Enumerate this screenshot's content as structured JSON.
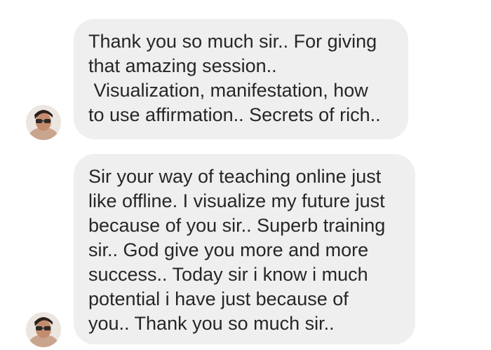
{
  "messages": [
    {
      "lines": [
        "Thank you so much sir.. For giving",
        "that amazing session..",
        " Visualization, manifestation, how",
        "to use affirmation.. Secrets of rich.."
      ]
    },
    {
      "lines": [
        "Sir your way of teaching online just",
        "like offline. I visualize my future just",
        "because of you sir.. Superb training",
        "sir.. God give you more and more",
        "success.. Today sir i know i much",
        "potential i have just because of",
        "you.. Thank you so much sir.."
      ]
    }
  ],
  "colors": {
    "bubble_bg": "#efefef",
    "text": "#262626",
    "background": "#ffffff"
  }
}
